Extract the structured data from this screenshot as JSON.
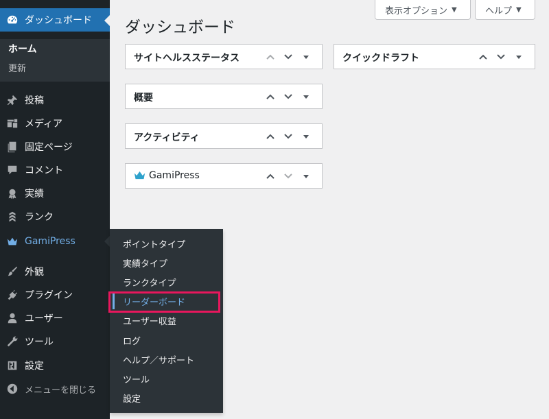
{
  "sidebar": {
    "dashboard": {
      "label": "ダッシュボード",
      "icon": "dashboard-gauge-icon"
    },
    "dashboard_submenu": [
      {
        "label": "ホーム",
        "current": true
      },
      {
        "label": "更新",
        "current": false
      }
    ],
    "items": [
      {
        "label": "投稿",
        "icon": "pin-icon"
      },
      {
        "label": "メディア",
        "icon": "media-icon"
      },
      {
        "label": "固定ページ",
        "icon": "pages-icon"
      },
      {
        "label": "コメント",
        "icon": "comment-icon"
      },
      {
        "label": "実績",
        "icon": "award-icon"
      },
      {
        "label": "ランク",
        "icon": "rank-icon"
      },
      {
        "label": "GamiPress",
        "icon": "crown-icon"
      },
      {
        "label": "外観",
        "icon": "paintbrush-icon"
      },
      {
        "label": "プラグイン",
        "icon": "plug-icon"
      },
      {
        "label": "ユーザー",
        "icon": "user-icon"
      },
      {
        "label": "ツール",
        "icon": "wrench-icon"
      },
      {
        "label": "設定",
        "icon": "settings-icon"
      }
    ],
    "collapse": {
      "label": "メニューを閉じる",
      "icon": "collapse-icon"
    }
  },
  "flyout": {
    "items": [
      {
        "label": "ポイントタイプ"
      },
      {
        "label": "実績タイプ"
      },
      {
        "label": "ランクタイプ"
      },
      {
        "label": "リーダーボード",
        "current": true
      },
      {
        "label": "ユーザー収益"
      },
      {
        "label": "ログ"
      },
      {
        "label": "ヘルプ／サポート"
      },
      {
        "label": "ツール"
      },
      {
        "label": "設定"
      }
    ]
  },
  "header": {
    "title": "ダッシュボード",
    "screen_options": "表示オプション",
    "help": "ヘルプ"
  },
  "widgets": {
    "site_health": "サイトヘルスステータス",
    "quick_draft": "クイックドラフト",
    "overview": "概要",
    "activity": "アクティビティ",
    "gamipress": "GamiPress"
  },
  "colors": {
    "sidebar_bg": "#1d2327",
    "submenu_bg": "#2c3338",
    "accent": "#2271b1",
    "current_link": "#72aee6",
    "highlight": "#e8175d",
    "gamipress_crown": "#2ea2cc"
  }
}
